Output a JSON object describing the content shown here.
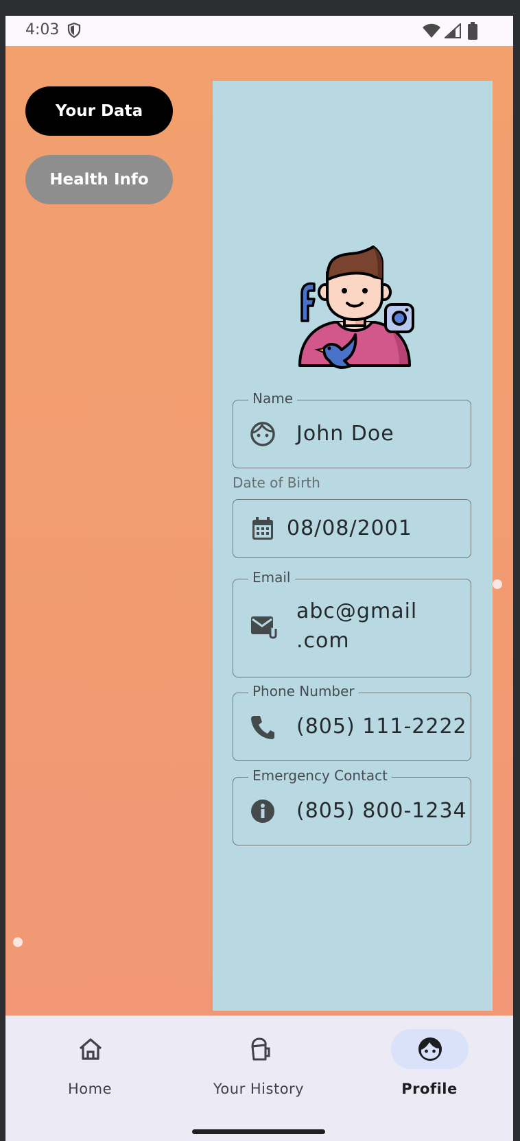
{
  "status_bar": {
    "time": "4:03",
    "icons": [
      "shield-icon",
      "wifi-icon",
      "signal-icon",
      "battery-icon"
    ]
  },
  "side_buttons": {
    "your_data": "Your Data",
    "health_info": "Health Info"
  },
  "profile_card": {
    "avatar": "person-with-social-icons-illustration",
    "fields": {
      "name": {
        "label": "Name",
        "value": "John Doe",
        "icon": "face-icon"
      },
      "dob": {
        "label": "Date of Birth",
        "value": "08/08/2001",
        "icon": "calendar-icon"
      },
      "email": {
        "label": "Email",
        "value_line1": "abc@gmail",
        "value_line2": ".com",
        "icon": "mail-attachment-icon"
      },
      "phone": {
        "label": "Phone Number",
        "value": "(805) 111-2222",
        "icon": "phone-icon"
      },
      "emergency": {
        "label": "Emergency Contact",
        "value": "(805) 800-1234",
        "icon": "info-icon"
      }
    }
  },
  "bottom_nav": {
    "items": [
      {
        "label": "Home",
        "icon": "home-icon",
        "active": false
      },
      {
        "label": "Your History",
        "icon": "history-icon",
        "active": false
      },
      {
        "label": "Profile",
        "icon": "face-icon",
        "active": true
      }
    ]
  },
  "colors": {
    "background_top": "#f2a06e",
    "background_bottom": "#f19775",
    "panel": "#b8d8e2",
    "primary_button": "#000000",
    "secondary_button": "#8e8e8e",
    "nav_background": "#eceaf4",
    "nav_active_pill": "#d9e2f8"
  }
}
